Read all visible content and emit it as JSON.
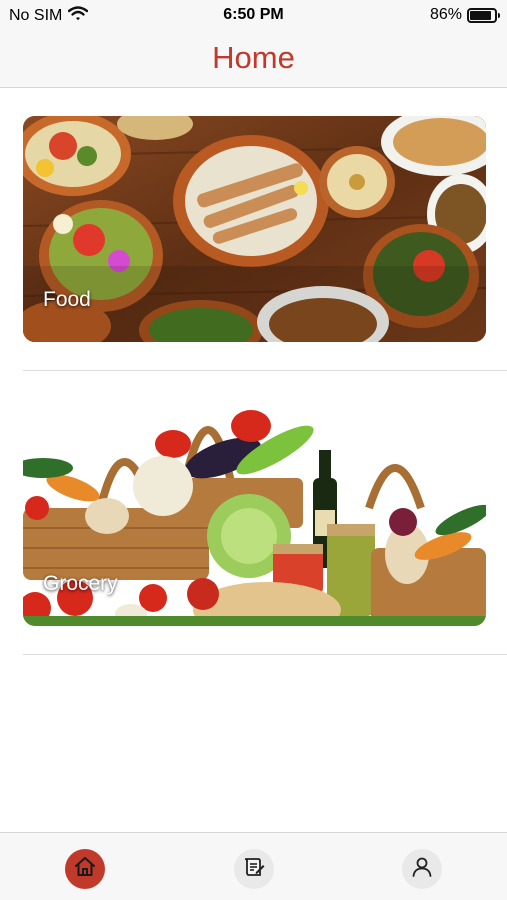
{
  "status_bar": {
    "carrier": "No SIM",
    "time": "6:50 PM",
    "battery_percent_label": "86%",
    "battery_level": 0.86
  },
  "nav": {
    "title": "Home"
  },
  "categories": [
    {
      "label": "Food"
    },
    {
      "label": "Grocery"
    }
  ],
  "tab_bar": {
    "items": [
      {
        "icon": "home-icon",
        "active": true
      },
      {
        "icon": "orders-icon",
        "active": false
      },
      {
        "icon": "profile-icon",
        "active": false
      }
    ]
  },
  "colors": {
    "accent": "#c0392b",
    "bar_background": "#f7f7f7",
    "inactive_tab": "#e9e9e9"
  }
}
